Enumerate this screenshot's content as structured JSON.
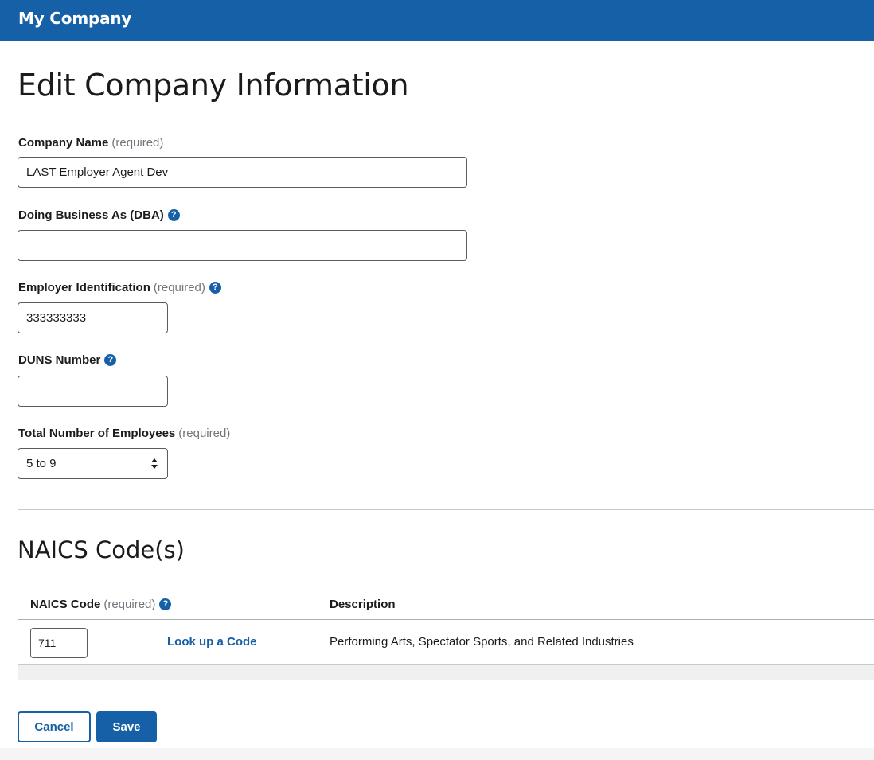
{
  "header": {
    "title": "My Company"
  },
  "page": {
    "title": "Edit Company Information"
  },
  "form": {
    "required_text": "(required)",
    "help_icon_glyph": "?",
    "company_name": {
      "label": "Company Name",
      "value": "LAST Employer Agent Dev"
    },
    "dba": {
      "label": "Doing Business As (DBA)",
      "value": ""
    },
    "employer_id": {
      "label": "Employer Identification",
      "value": "333333333"
    },
    "duns": {
      "label": "DUNS Number",
      "value": ""
    },
    "employees": {
      "label": "Total Number of Employees",
      "selected": "5 to 9"
    }
  },
  "naics": {
    "title": "NAICS Code(s)",
    "columns": {
      "code": "NAICS Code",
      "description": "Description"
    },
    "rows": [
      {
        "code": "711",
        "lookup_label": "Look up a Code",
        "description": "Performing Arts, Spectator Sports, and Related Industries"
      }
    ]
  },
  "actions": {
    "cancel_label": "Cancel",
    "save_label": "Save"
  },
  "colors": {
    "brand": "#1560a6",
    "border": "#565c65",
    "muted": "#71767a"
  },
  "icons": {
    "help": "question-circle-icon",
    "select": "sort-arrows-icon"
  }
}
